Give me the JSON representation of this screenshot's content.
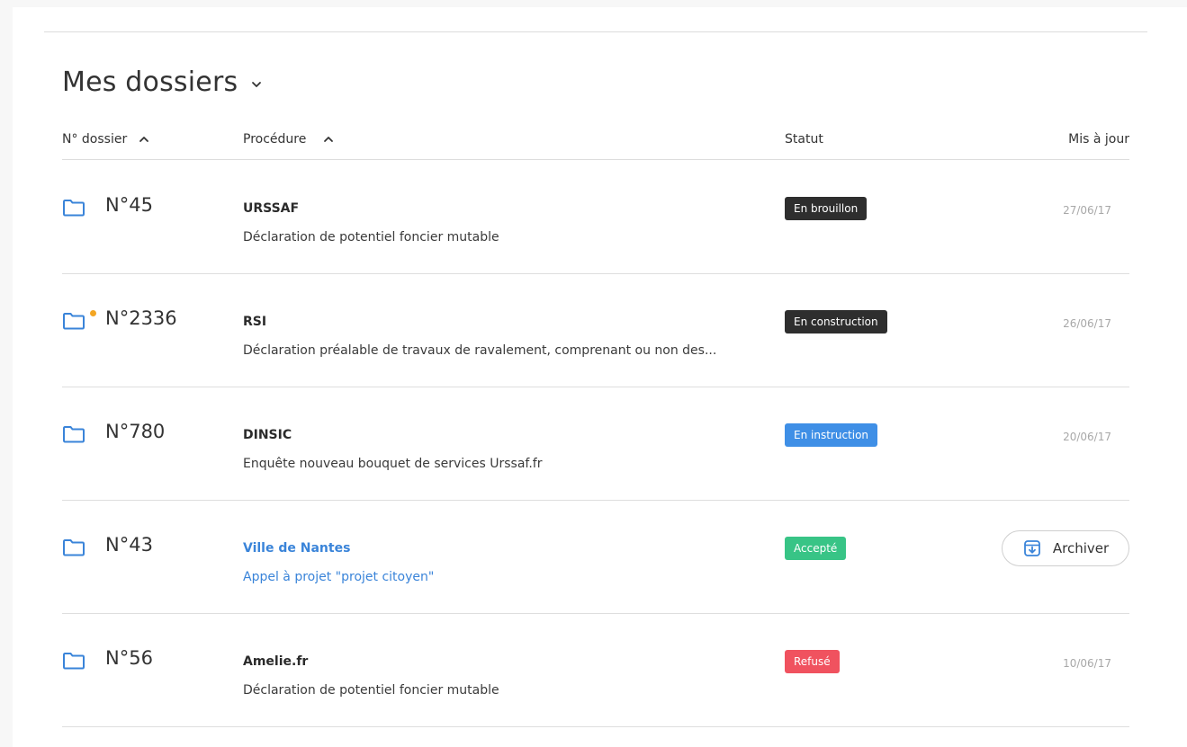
{
  "page": {
    "title": "Mes dossiers"
  },
  "columns": {
    "dossier": "N° dossier",
    "procedure": "Procédure",
    "statut": "Statut",
    "maj": "Mis à jour"
  },
  "colors": {
    "accent": "#3a84d9",
    "draft": "#2e2e2e",
    "instruction": "#3f8fe6",
    "accepted": "#38c486",
    "refused": "#f0525f",
    "notification": "#f3a623"
  },
  "rows": [
    {
      "number": "N°45",
      "org": "URSSAF",
      "procedure": "Déclaration de potentiel foncier mutable",
      "status": "En brouillon",
      "date": "27/06/17"
    },
    {
      "number": "N°2336",
      "org": "RSI",
      "procedure": "Déclaration préalable de travaux de ravalement, comprenant ou non des...",
      "status": "En construction",
      "date": "26/06/17"
    },
    {
      "number": "N°780",
      "org": "DINSIC",
      "procedure": "Enquête nouveau bouquet de services Urssaf.fr",
      "status": "En instruction",
      "date": "20/06/17"
    },
    {
      "number": "N°43",
      "org": "Ville de Nantes",
      "procedure": "Appel à projet \"projet citoyen\"",
      "status": "Accepté",
      "action": "Archiver"
    },
    {
      "number": "N°56",
      "org": "Amelie.fr",
      "procedure": "Déclaration de potentiel foncier mutable",
      "status": "Refusé",
      "date": "10/06/17"
    }
  ]
}
